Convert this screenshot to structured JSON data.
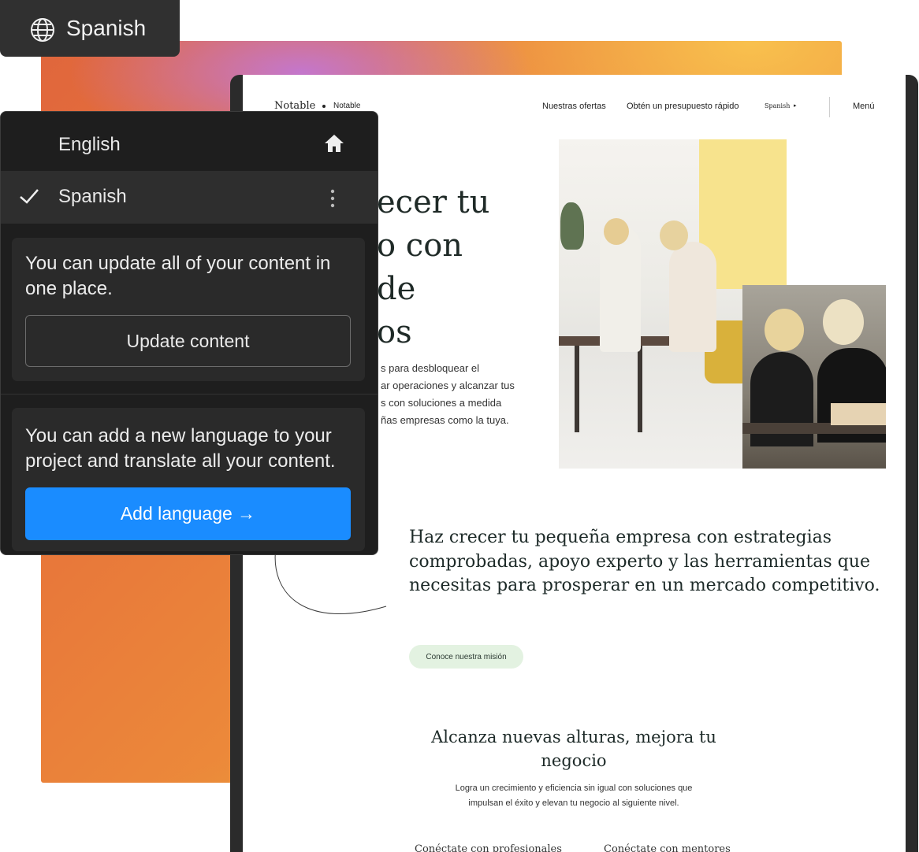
{
  "toolbar": {
    "language_label": "Spanish"
  },
  "language_panel": {
    "languages": [
      {
        "label": "English",
        "icon": "home-icon"
      },
      {
        "label": "Spanish",
        "icon": "more-icon",
        "selected": true
      }
    ],
    "update_card": {
      "text": "You can update all of your content in one place.",
      "button_label": "Update content"
    },
    "add_card": {
      "text": "You can add a new language to your project and translate all your content.",
      "button_label": "Add language →"
    },
    "colors": {
      "primary": "#1a8cff",
      "panel_bg": "#1e1e1e"
    }
  },
  "site": {
    "brand": "Notable",
    "brand_sub": "Notable",
    "nav": {
      "link1": "Nuestras ofertas",
      "link2": "Obtén un presupuesto rápido",
      "language": "Spanish",
      "menu": "Menú"
    },
    "hero": {
      "title_lines": [
        "ecer tu",
        "o con",
        "de",
        "os"
      ],
      "body_lines": [
        "s para desbloquear el",
        "ar operaciones y alcanzar tus",
        "s con soluciones a medida",
        "ñas empresas como la tuya."
      ]
    },
    "mission": {
      "text": "Haz crecer tu pequeña empresa con estrategias comprobadas, apoyo experto y las herramientas que necesitas para prosperar en un mercado competitivo.",
      "button_label": "Conoce nuestra misión"
    },
    "section": {
      "title": "Alcanza nuevas alturas, mejora tu negocio",
      "subtitle": "Logra un crecimiento y eficiencia sin igual con soluciones que impulsan el éxito y elevan tu negocio al siguiente nivel.",
      "cut_left": "Conéctate con profesionales",
      "cut_right": "Conéctate con mentores"
    }
  }
}
